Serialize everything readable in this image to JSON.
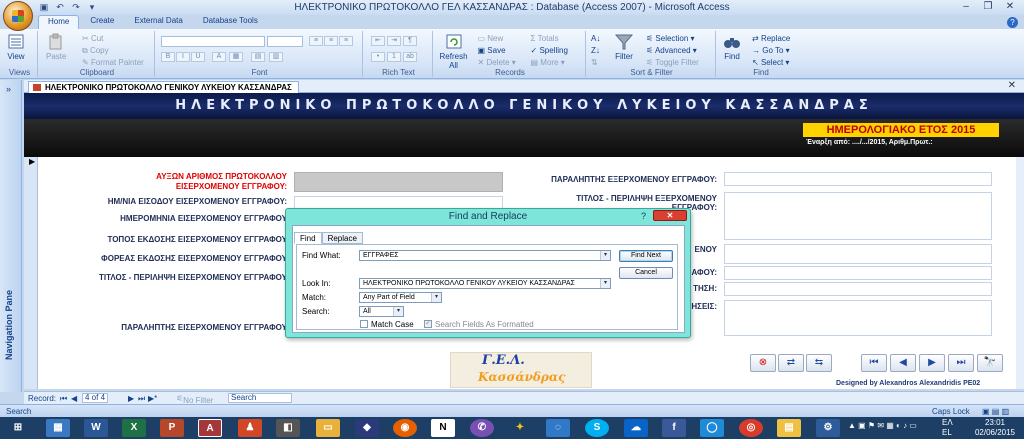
{
  "window": {
    "title": "ΗΛΕΚΤΡΟΝΙΚΟ ΠΡΩΤΟΚΟΛΛΟ ΓΕΛ ΚΑΣΣΑΝΔΡΑΣ : Database (Access 2007) - Microsoft Access"
  },
  "ribbon": {
    "tabs": [
      "Home",
      "Create",
      "External Data",
      "Database Tools"
    ],
    "groups": {
      "views": {
        "label": "Views",
        "view": "View"
      },
      "clipboard": {
        "label": "Clipboard",
        "paste": "Paste",
        "cut": "Cut",
        "copy": "Copy",
        "format_painter": "Format Painter"
      },
      "font": {
        "label": "Font"
      },
      "rich_text": {
        "label": "Rich Text"
      },
      "records": {
        "label": "Records",
        "refresh": "Refresh",
        "refresh_sub": "All",
        "new": "New",
        "save": "Save",
        "delete": "Delete",
        "totals": "Totals",
        "spelling": "Spelling",
        "more": "More"
      },
      "sort_filter": {
        "label": "Sort & Filter",
        "filter": "Filter",
        "selection": "Selection",
        "advanced": "Advanced",
        "toggle_filter": "Toggle Filter"
      },
      "find": {
        "label": "Find",
        "find": "Find",
        "replace": "Replace",
        "goto": "Go To",
        "select": "Select"
      }
    }
  },
  "nav_pane": {
    "label": "Navigation Pane"
  },
  "form": {
    "tab_title": "ΗΛΕΚΤΡΟΝΙΚΟ ΠΡΩΤΟΚΟΛΛΟ ΓΕΝΙΚΟΥ ΛΥΚΕΙΟΥ ΚΑΣΣΑΝΔΡΑΣ",
    "header_title": "ΗΛΕΚΤΡΟΝΙΚΟ ΠΡΩΤΟΚΟΛΛΟ ΓΕΝΙΚΟΥ ΛΥΚΕΙΟΥ ΚΑΣΣΑΝΔΡΑΣ",
    "year_label": "ΗΜΕΡΟΛΟΓΙΑΚΟ ΕΤΟΣ 2015",
    "start_label": "Έναρξη από: ..../.../2015, Αριθμ.Πρωτ.:",
    "left_labels": {
      "protocol_1": "ΑΥΞΩΝ ΑΡΙΘΜΟΣ ΠΡΩΤΟΚΟΛΛΟΥ",
      "protocol_2": "ΕΙΣΕΡΧΟΜΕΝΟΥ ΕΓΓΡΑΦΟΥ:",
      "entry_date": "ΗΜ/ΝΙΑ ΕΙΣΟΔΟΥ ΕΙΣΕΡΧΟΜΕΝΟΥ ΕΓΓΡΑΦΟΥ:",
      "doc_date": "ΗΜΕΡΟΜΗΝΙΑ ΕΙΣΕΡΧΟΜΕΝΟΥ ΕΓΓΡΑΦΟΥ",
      "issue_place": "ΤΟΠΟΣ ΕΚΔΟΣΗΣ ΕΙΣΕΡΧΟΜΕΝΟΥ ΕΓΓΡΑΦΟΥ",
      "issuer": "ΦΟΡΕΑΣ ΕΚΔΟΣΗΣ ΕΙΣΕΡΧΟΜΕΝΟΥ ΕΓΓΡΑΦΟΥ",
      "title_summary": "ΤΙΤΛΟΣ - ΠΕΡΙΛΗΨΗ ΕΙΣΕΡΧΟΜΕΝΟΥ ΕΓΓΡΑΦΟΥ",
      "recipient": "ΠΑΡΑΛΗΠΤΗΣ ΕΙΣΕΡΧΟΜΕΝΟΥ ΕΓΓΡΑΦΟΥ"
    },
    "right_labels": {
      "recipient_out": "ΠΑΡΑΛΗΠΤΗΣ ΕΞΕΡΧΟΜΕΝΟΥ ΕΓΓΡΑΦΟΥ:",
      "title_out_1": "ΤΙΤΛΟΣ - ΠΕΡΙΛΗΨΗ ΕΞΕΡΧΟΜΕΝΟΥ",
      "title_out_2": "ΕΓΓΡΑΦΟΥ:",
      "partial_1": "ΕΝΟΥ",
      "partial_2": "ΑΦΟΥ:",
      "partial_3": "ΤΗΣΗ:",
      "partial_4": "ΗΣΕΙΣ:"
    },
    "logo": {
      "line1": "Γ.Ε.Λ.",
      "line2": "Κασσάνδρας"
    },
    "designed_by": "Designed by Alexandros Alexandridis PE02",
    "nav_buttons": [
      "⊗",
      "⇄",
      "⇆",
      "⏮",
      "◀",
      "▶",
      "⏭",
      "🔭"
    ]
  },
  "dialog": {
    "title": "Find and Replace",
    "help": "?",
    "close": "✕",
    "tabs": [
      "Find",
      "Replace"
    ],
    "find_what_label": "Find What:",
    "find_what_value": "ΕΓΓΡΑΦΕΣ",
    "look_in_label": "Look In:",
    "look_in_value": "ΗΛΕΚΤΡΟΝΙΚΟ ΠΡΩΤΟΚΟΛΛΟ ΓΕΝΙΚΟΥ ΛΥΚΕΙΟΥ ΚΑΣΣΑΝΔΡΑΣ",
    "match_label": "Match:",
    "match_value": "Any Part of Field",
    "search_label": "Search:",
    "search_value": "All",
    "match_case": "Match Case",
    "search_formatted": "Search Fields As Formatted",
    "find_next": "Find Next",
    "cancel": "Cancel"
  },
  "record_nav": {
    "label": "Record:",
    "position": "4 of 4",
    "filter": "No Filter",
    "search": "Search"
  },
  "status": {
    "left": "Search",
    "caps": "Caps Lock"
  },
  "taskbar": {
    "lang": "ΕΛ",
    "lang2": "EL",
    "time": "23:01",
    "date": "02/06/2015"
  }
}
